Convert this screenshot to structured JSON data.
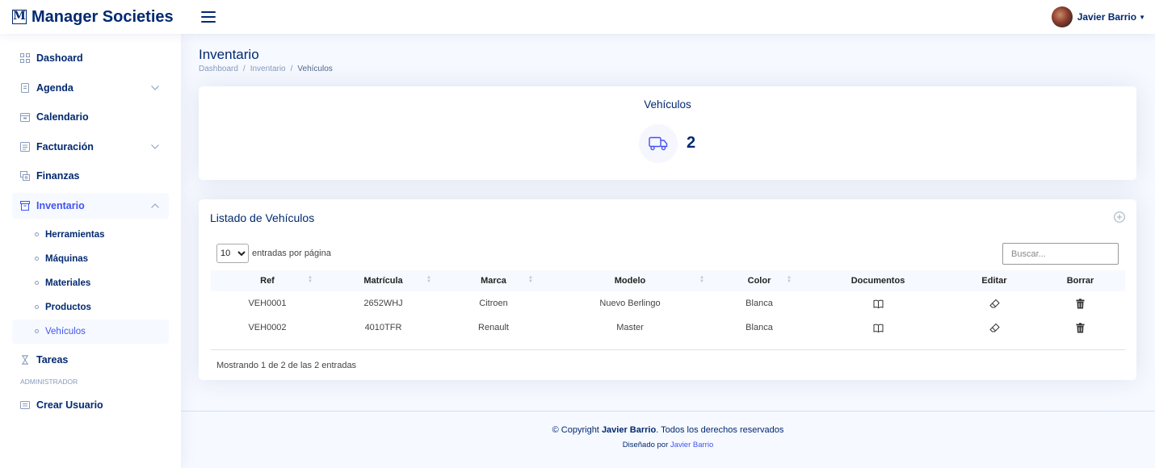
{
  "header": {
    "logo_letter": "M",
    "logo_text": "Manager Societies",
    "user_name": "Javier Barrio"
  },
  "sidebar": {
    "items": [
      {
        "label": "Dashoard"
      },
      {
        "label": "Agenda"
      },
      {
        "label": "Calendario"
      },
      {
        "label": "Facturación"
      },
      {
        "label": "Finanzas"
      },
      {
        "label": "Inventario"
      }
    ],
    "sub_items": [
      {
        "label": "Herramientas"
      },
      {
        "label": "Máquinas"
      },
      {
        "label": "Materiales"
      },
      {
        "label": "Productos"
      },
      {
        "label": "Vehículos"
      }
    ],
    "tareas": "Tareas",
    "admin_heading": "ADMINISTRADOR",
    "crear_usuario": "Crear Usuario"
  },
  "page": {
    "title": "Inventario",
    "breadcrumb": [
      "Dashboard",
      "Inventario",
      "Vehículos"
    ]
  },
  "stat": {
    "title": "Vehículos",
    "value": "2"
  },
  "list": {
    "title": "Listado de Vehículos",
    "length_value": "10",
    "length_label": "entradas por página",
    "search_placeholder": "Buscar...",
    "columns": [
      "Ref",
      "Matrícula",
      "Marca",
      "Modelo",
      "Color",
      "Documentos",
      "Editar",
      "Borrar"
    ],
    "rows": [
      {
        "ref": "VEH0001",
        "matricula": "2652WHJ",
        "marca": "Citroen",
        "modelo": "Nuevo Berlingo",
        "color": "Blanca"
      },
      {
        "ref": "VEH0002",
        "matricula": "4010TFR",
        "marca": "Renault",
        "modelo": "Master",
        "color": "Blanca"
      }
    ],
    "info": "Mostrando 1 de 2 de las 2 entradas"
  },
  "footer": {
    "copyright_prefix": "© Copyright",
    "copyright_name": "Javier Barrio",
    "copyright_suffix": ". Todos los derechos reservados",
    "designed_prefix": "Diseñado por",
    "designed_name": "Javier Barrio"
  },
  "colors": {
    "primary": "#012970",
    "accent": "#4154f1",
    "background": "#f6f9ff"
  }
}
